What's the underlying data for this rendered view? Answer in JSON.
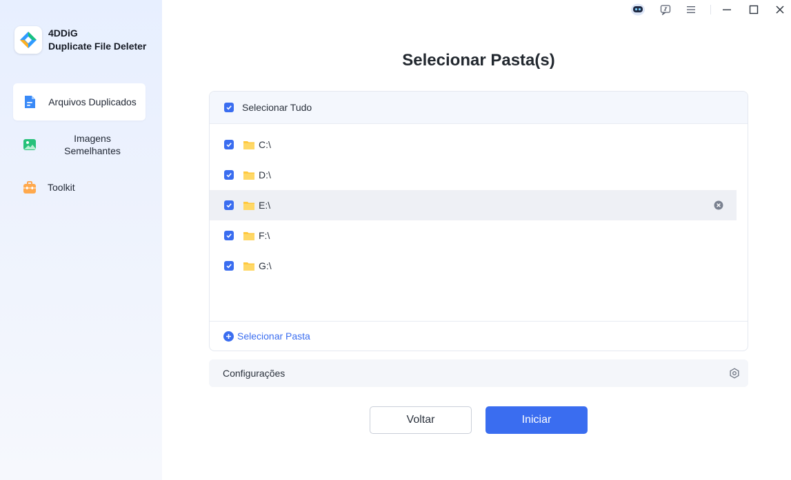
{
  "app": {
    "name_line1": "4DDiG",
    "name_line2": "Duplicate File Deleter"
  },
  "sidebar": {
    "items": [
      {
        "label": "Arquivos Duplicados",
        "icon": "document-icon",
        "active": true
      },
      {
        "label": "Imagens Semelhantes",
        "icon": "image-icon",
        "active": false
      },
      {
        "label": "Toolkit",
        "icon": "toolbox-icon",
        "active": false
      }
    ]
  },
  "titlebar": {
    "icons": [
      "assistant-robot-icon",
      "feedback-icon",
      "menu-icon",
      "minimize-icon",
      "maximize-icon",
      "close-icon"
    ]
  },
  "main": {
    "title": "Selecionar Pasta(s)",
    "select_all_label": "Selecionar Tudo",
    "drives": [
      {
        "label": "C:\\",
        "checked": true
      },
      {
        "label": "D:\\",
        "checked": true
      },
      {
        "label": "E:\\",
        "checked": true,
        "hovered": true
      },
      {
        "label": "F:\\",
        "checked": true
      },
      {
        "label": "G:\\",
        "checked": true
      }
    ],
    "add_folder_label": "Selecionar Pasta",
    "settings_label": "Configurações",
    "back_label": "Voltar",
    "start_label": "Iniciar"
  },
  "colors": {
    "accent": "#3a6df0",
    "folder": "#ffc83d",
    "sidebar_bg": "#e7efff"
  }
}
